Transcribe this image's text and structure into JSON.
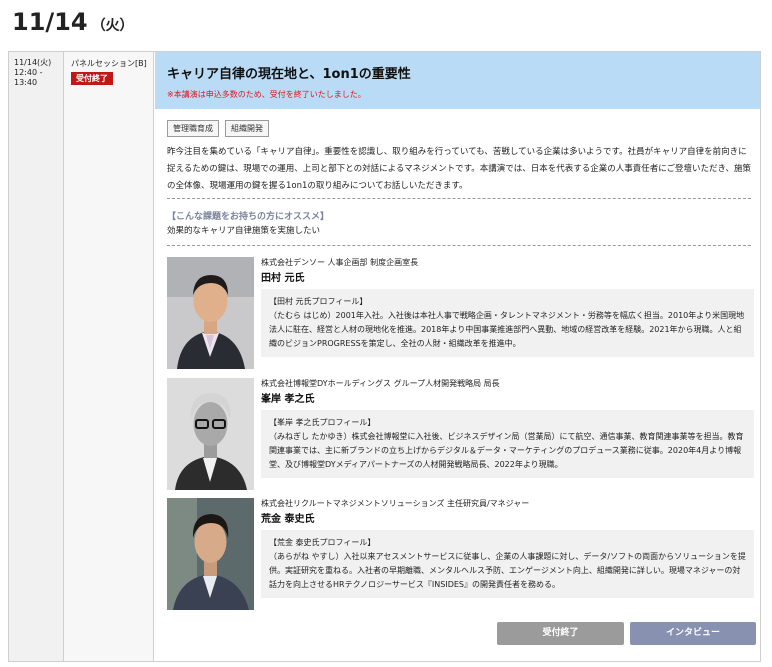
{
  "header": {
    "date": "11/14",
    "dow": "（火）"
  },
  "session": {
    "time_lines": [
      "11/14(火)",
      "12:40 -",
      "13:40"
    ],
    "type_label": "パネルセッション[B]",
    "status_badge": "受付終了",
    "title": "キャリア自律の現在地と、1on1の重要性",
    "notice": "※本講演は申込多数のため、受付を終了いたしました。",
    "tags": [
      "管理職育成",
      "組織開発"
    ],
    "description": "昨今注目を集めている「キャリア自律」。重要性を認識し、取り組みを行っていても、苦戦している企業は多いようです。社員がキャリア自律を前向きに捉えるための鍵は、現場での運用、上司と部下との対話によるマネジメントです。本講演では、日本を代表する企業の人事責任者にご登壇いただき、施策の全体像、現場運用の鍵を握る1on1の取り組みについてお話しいただきます。",
    "recommend_heading": "【こんな課題をお持ちの方にオススメ】",
    "recommend_text": "効果的なキャリア自律施策を実施したい"
  },
  "speakers": [
    {
      "org": "株式会社デンソー 人事企画部 制度企画室長",
      "name": "田村 元氏",
      "profile_head": "【田村 元氏プロフィール】",
      "profile_body": "（たむら はじめ）2001年入社。入社後は本社人事で戦略企画・タレントマネジメント・労務等を幅広く担当。2010年より米国現地法人に駐在、経営と人材の現地化を推進。2018年より中国事業推進部門へ異動、地域の経営改革を経験。2021年から現職。人と組織のビジョンPROGRESSを策定し、全社の人財・組織改革を推進中。"
    },
    {
      "org": "株式会社博報堂DYホールディングス グループ人材開発戦略局 局長",
      "name": "峯岸 孝之氏",
      "profile_head": "【峯岸 孝之氏プロフィール】",
      "profile_body": "（みねぎし たかゆき）株式会社博報堂に入社後、ビジネスデザイン局（営業局）にて航空、通信事業、教育関連事業等を担当。教育関連事業では、主に新ブランドの立ち上げからデジタル＆データ・マーケティングのプロデュース業務に従事。2020年4月より博報堂、及び博報堂DYメディアパートナーズの人材開発戦略局長、2022年より現職。"
    },
    {
      "org": "株式会社リクルートマネジメントソリューションズ 主任研究員/マネジャー",
      "name": "荒金 泰史氏",
      "profile_head": "【荒金 泰史氏プロフィール】",
      "profile_body": "（あらがね やすし）入社以来アセスメントサービスに従事し、企業の人事課題に対し、データ/ソフトの両面からソリューションを提供。実証研究を重ねる。入社者の早期離職、メンタルヘルス予防、エンゲージメント向上、組織開発に詳しい。現場マネジャーの対話力を向上させるHRテクノロジーサービス『INSIDES』の開発責任者を務める。"
    }
  ],
  "buttons": {
    "closed": "受付終了",
    "interview": "インタビュー"
  }
}
